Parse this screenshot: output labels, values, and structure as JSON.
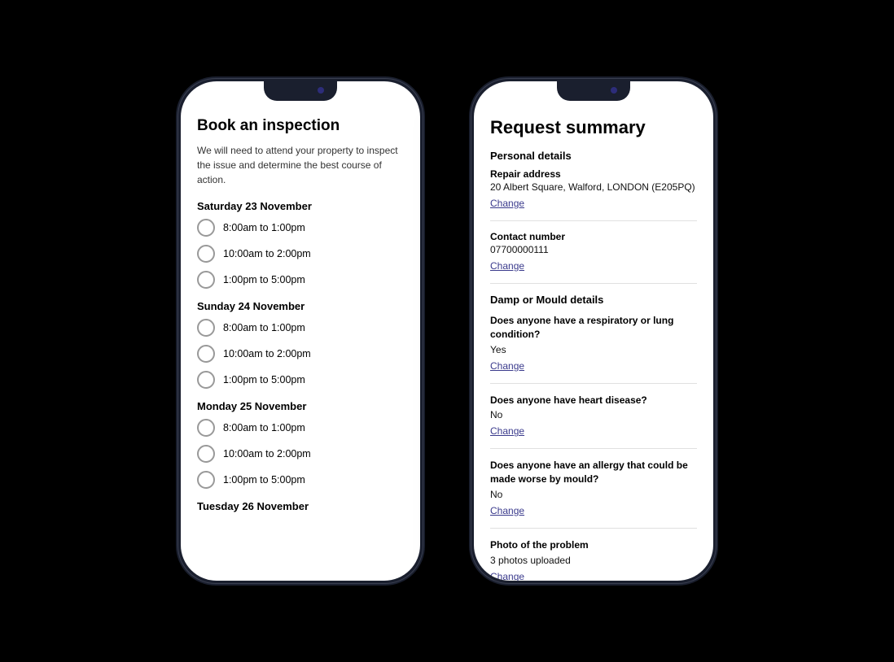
{
  "phone1": {
    "title": "Book an inspection",
    "subtitle": "We will need to attend your property to inspect the issue and determine the best course of action.",
    "days": [
      {
        "label": "Saturday 23 November",
        "slots": [
          "8:00am to 1:00pm",
          "10:00am to 2:00pm",
          "1:00pm to 5:00pm"
        ]
      },
      {
        "label": "Sunday 24 November",
        "slots": [
          "8:00am to 1:00pm",
          "10:00am to 2:00pm",
          "1:00pm to 5:00pm"
        ]
      },
      {
        "label": "Monday 25 November",
        "slots": [
          "8:00am to 1:00pm",
          "10:00am to 2:00pm",
          "1:00pm to 5:00pm"
        ]
      },
      {
        "label": "Tuesday 26 November",
        "slots": []
      }
    ]
  },
  "phone2": {
    "title": "Request summary",
    "personal_details_heading": "Personal details",
    "repair_address_label": "Repair address",
    "repair_address_value": "20 Albert Square, Walford, LONDON (E205PQ)",
    "change_label": "Change",
    "contact_number_label": "Contact number",
    "contact_number_value": "07700000111",
    "damp_mould_heading": "Damp or Mould details",
    "questions": [
      {
        "question": "Does anyone have a respiratory or lung condition?",
        "answer": "Yes"
      },
      {
        "question": "Does anyone have heart disease?",
        "answer": "No"
      },
      {
        "question": "Does anyone have an allergy that could be made worse by mould?",
        "answer": "No"
      },
      {
        "question": "Photo of the problem",
        "answer": "3 photos uploaded"
      }
    ]
  }
}
